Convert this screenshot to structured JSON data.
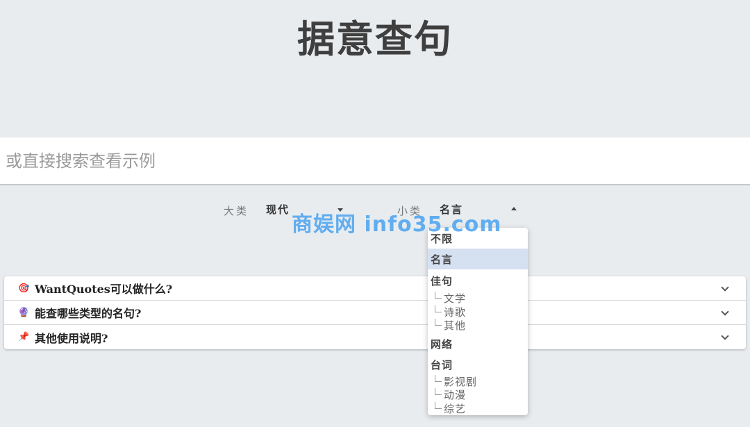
{
  "app_title": "据意查句",
  "search": {
    "placeholder": "或直接搜索查看示例"
  },
  "filters": {
    "major": {
      "label": "大类",
      "value": "现代"
    },
    "minor": {
      "label": "小类",
      "value": "名言"
    }
  },
  "dropdown": {
    "options": [
      {
        "label": "不限"
      },
      {
        "label": "名言",
        "selected": true
      },
      {
        "label": "佳句",
        "children": [
          "文学",
          "诗歌",
          "其他"
        ]
      },
      {
        "label": "网络"
      },
      {
        "label": "台词",
        "children": [
          "影视剧",
          "动漫",
          "综艺"
        ]
      }
    ]
  },
  "faq": [
    {
      "icon": "🎯",
      "icon_name": "target-icon",
      "title": "WantQuotes可以做什么?"
    },
    {
      "icon": "🔮",
      "icon_name": "crystal-ball-icon",
      "title": "能查哪些类型的名句?"
    },
    {
      "icon": "📌",
      "icon_name": "pushpin-icon",
      "title": "其他使用说明?"
    }
  ],
  "watermark": "商娱网 info35.com",
  "colors": {
    "background": "#e9ecef",
    "selected_option": "#d5e1f1",
    "watermark": "#4aa3f0"
  }
}
